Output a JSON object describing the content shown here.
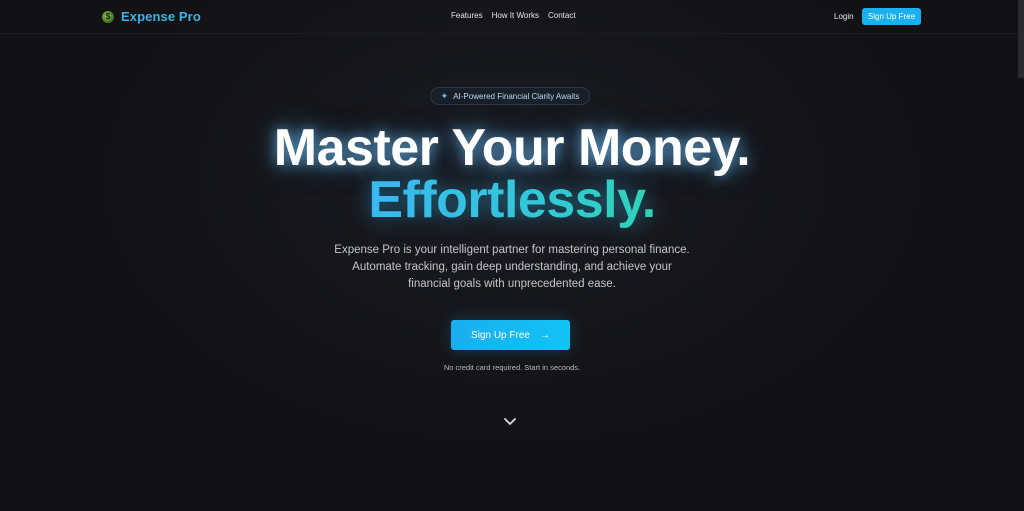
{
  "nav": {
    "brand_name": "Expense Pro",
    "brand_logo_icon": "leaf-coin-icon",
    "links": [
      "Features",
      "How It Works",
      "Contact"
    ],
    "login_label": "Login",
    "signup_label": "Sign Up Free"
  },
  "hero": {
    "badge_icon": "sparkle-icon",
    "badge_text": "AI-Powered Financial Clarity Awaits",
    "headline_line1": "Master Your Money.",
    "headline_line2": "Effortlessly.",
    "description_lines": [
      "Expense Pro is your intelligent partner for mastering personal finance.",
      "Automate tracking, gain deep understanding, and achieve your",
      "financial goals with unprecedented ease."
    ],
    "cta_label": "Sign Up Free",
    "cta_icon": "arrow-right-icon",
    "note": "No credit card required. Start in seconds.",
    "scroll_icon": "chevron-down-icon"
  },
  "colors": {
    "accent": "#1ab0ef",
    "brand": "#3cb4e6",
    "gradient_end": "#2ed3b4",
    "background": "#121215"
  }
}
